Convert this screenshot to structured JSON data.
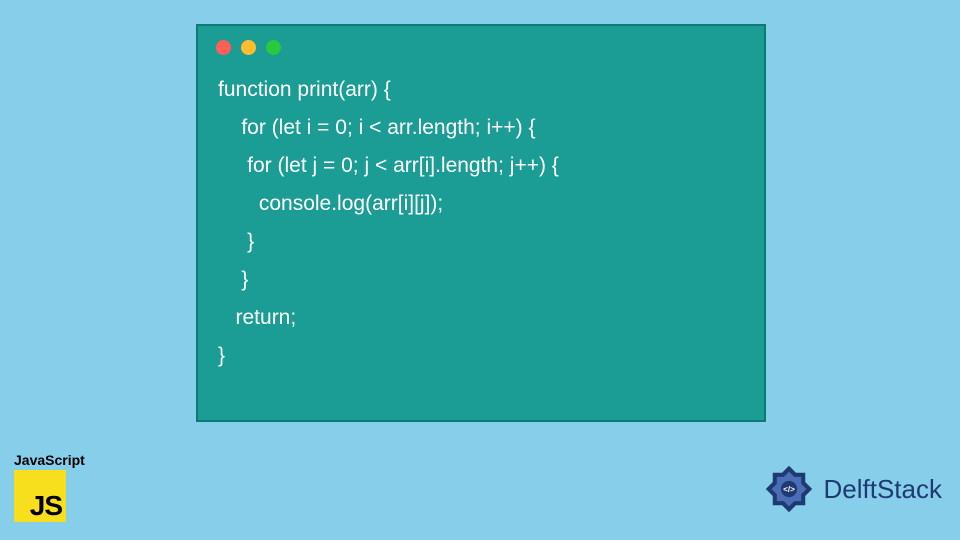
{
  "code": {
    "lines": [
      "function print(arr) {",
      "    for (let i = 0; i < arr.length; i++) {",
      "     for (let j = 0; j < arr[i].length; j++) {",
      "       console.log(arr[i][j]);",
      "     }",
      "    }",
      "   return;",
      "}"
    ]
  },
  "badge": {
    "language_label": "JavaScript",
    "language_logo_text": "JS"
  },
  "brand": {
    "name": "DelftStack"
  },
  "colors": {
    "background": "#87ceeb",
    "panel": "#1b9c94",
    "js_yellow": "#f7df1e",
    "brand_blue": "#1f3a72"
  }
}
